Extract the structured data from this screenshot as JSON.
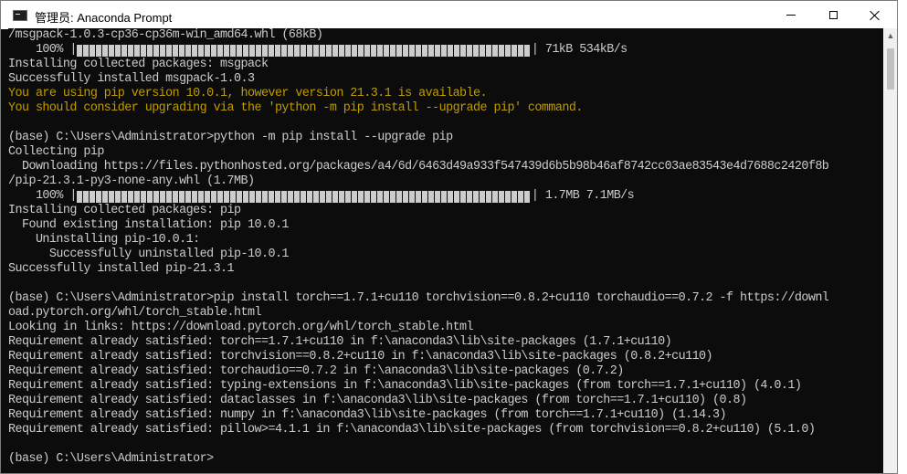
{
  "window": {
    "title": "管理员: Anaconda Prompt",
    "icon": "console-icon",
    "controls": {
      "minimize": "minimize-icon",
      "maximize": "maximize-icon",
      "close": "close-icon"
    }
  },
  "console": {
    "lines": [
      {
        "type": "text",
        "text": "/msgpack-1.0.3-cp36-cp36m-win_amd64.whl (68kB)"
      },
      {
        "type": "progress",
        "pct": "    100% |",
        "suffix": "| 71kB 534kB/s",
        "progress": 1.0
      },
      {
        "type": "text",
        "text": "Installing collected packages: msgpack"
      },
      {
        "type": "text",
        "text": "Successfully installed msgpack-1.0.3"
      },
      {
        "type": "warn",
        "text": "You are using pip version 10.0.1, however version 21.3.1 is available."
      },
      {
        "type": "warn",
        "text": "You should consider upgrading via the 'python -m pip install --upgrade pip' command."
      },
      {
        "type": "text",
        "text": ""
      },
      {
        "type": "text",
        "text": "(base) C:\\Users\\Administrator>python -m pip install --upgrade pip"
      },
      {
        "type": "text",
        "text": "Collecting pip"
      },
      {
        "type": "text",
        "text": "  Downloading https://files.pythonhosted.org/packages/a4/6d/6463d49a933f547439d6b5b98b46af8742cc03ae83543e4d7688c2420f8b"
      },
      {
        "type": "text",
        "text": "/pip-21.3.1-py3-none-any.whl (1.7MB)"
      },
      {
        "type": "progress",
        "pct": "    100% |",
        "suffix": "| 1.7MB 7.1MB/s",
        "progress": 1.0
      },
      {
        "type": "text",
        "text": "Installing collected packages: pip"
      },
      {
        "type": "text",
        "text": "  Found existing installation: pip 10.0.1"
      },
      {
        "type": "text",
        "text": "    Uninstalling pip-10.0.1:"
      },
      {
        "type": "text",
        "text": "      Successfully uninstalled pip-10.0.1"
      },
      {
        "type": "text",
        "text": "Successfully installed pip-21.3.1"
      },
      {
        "type": "text",
        "text": ""
      },
      {
        "type": "text",
        "text": "(base) C:\\Users\\Administrator>pip install torch==1.7.1+cu110 torchvision==0.8.2+cu110 torchaudio==0.7.2 -f https://downl"
      },
      {
        "type": "text",
        "text": "oad.pytorch.org/whl/torch_stable.html"
      },
      {
        "type": "text",
        "text": "Looking in links: https://download.pytorch.org/whl/torch_stable.html"
      },
      {
        "type": "text",
        "text": "Requirement already satisfied: torch==1.7.1+cu110 in f:\\anaconda3\\lib\\site-packages (1.7.1+cu110)"
      },
      {
        "type": "text",
        "text": "Requirement already satisfied: torchvision==0.8.2+cu110 in f:\\anaconda3\\lib\\site-packages (0.8.2+cu110)"
      },
      {
        "type": "text",
        "text": "Requirement already satisfied: torchaudio==0.7.2 in f:\\anaconda3\\lib\\site-packages (0.7.2)"
      },
      {
        "type": "text",
        "text": "Requirement already satisfied: typing-extensions in f:\\anaconda3\\lib\\site-packages (from torch==1.7.1+cu110) (4.0.1)"
      },
      {
        "type": "text",
        "text": "Requirement already satisfied: dataclasses in f:\\anaconda3\\lib\\site-packages (from torch==1.7.1+cu110) (0.8)"
      },
      {
        "type": "text",
        "text": "Requirement already satisfied: numpy in f:\\anaconda3\\lib\\site-packages (from torch==1.7.1+cu110) (1.14.3)"
      },
      {
        "type": "text",
        "text": "Requirement already satisfied: pillow>=4.1.1 in f:\\anaconda3\\lib\\site-packages (from torchvision==0.8.2+cu110) (5.1.0)"
      },
      {
        "type": "text",
        "text": ""
      },
      {
        "type": "text",
        "text": "(base) C:\\Users\\Administrator>"
      }
    ]
  },
  "colors": {
    "console_bg": "#0c0c0c",
    "console_fg": "#cccccc",
    "warning_fg": "#c19c00"
  },
  "scrollbar": {
    "up_arrow": "scroll-up-arrow-icon"
  }
}
